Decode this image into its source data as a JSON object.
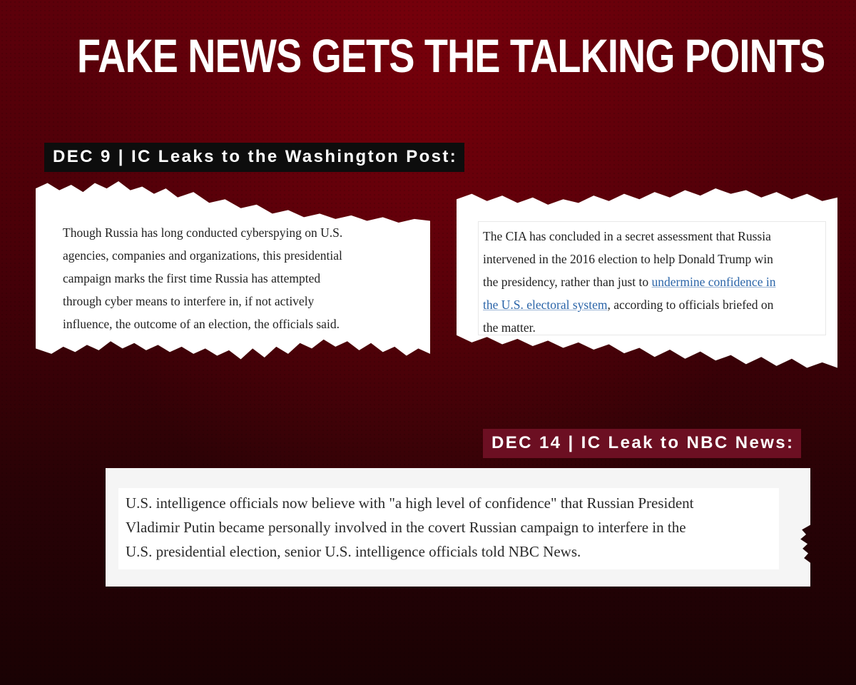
{
  "headline": "FAKE NEWS GETS THE TALKING POINTS",
  "tags": {
    "wapo": "DEC 9 | IC Leaks to the Washington Post:",
    "nbc": "DEC 14 | IC Leak to NBC News:"
  },
  "clips": {
    "wapo_left": {
      "lines": [
        "Though Russia has long conducted cyberspying on U.S.",
        "agencies, companies and organizations, this presidential",
        "campaign marks the first time Russia has attempted",
        "through cyber means to interfere in, if not actively",
        "influence, the outcome of an election, the officials said."
      ]
    },
    "wapo_right": {
      "line1": "The CIA has concluded in a secret assessment that Russia",
      "line2": "intervened in the 2016 election to help Donald Trump win",
      "line3_text": "the presidency, rather than just to ",
      "line3_link": "undermine confidence in",
      "line4_link": "the U.S. electoral system",
      "line4_text": ", according to officials briefed on",
      "line5": "the matter."
    },
    "nbc": {
      "lines": [
        "U.S. intelligence officials now believe with \"a high level of confidence\" that Russian President",
        "Vladimir Putin became personally involved in the covert Russian campaign to interfere in the",
        "U.S. presidential election, senior U.S. intelligence officials told NBC News."
      ]
    }
  },
  "colors": {
    "background_top": "#5d000a",
    "background_bottom": "#1a0204",
    "tag_wapo_bg": "#0d0d0d",
    "tag_nbc_bg": "#6c0f22",
    "link": "#2a64a8"
  }
}
